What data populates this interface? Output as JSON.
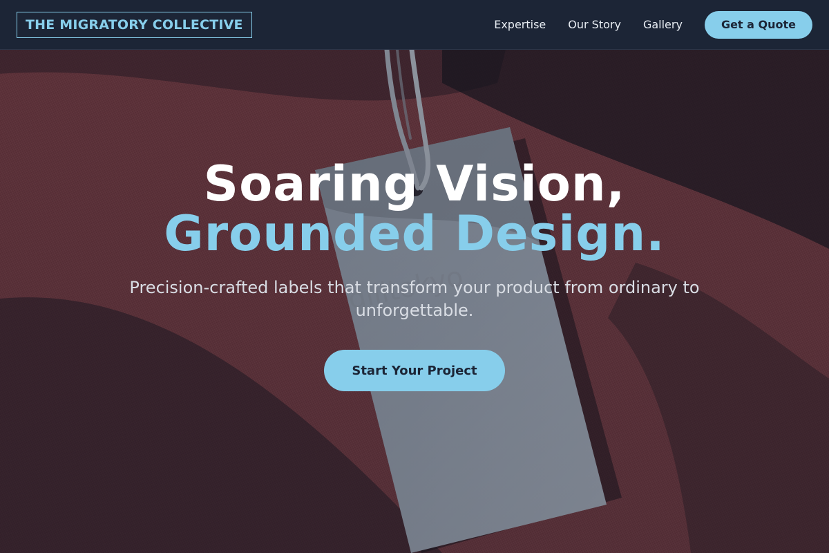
{
  "header": {
    "logo_text": "THE MIGRATORY COLLECTIVE",
    "nav": [
      {
        "label": "Expertise"
      },
      {
        "label": "Our Story"
      },
      {
        "label": "Gallery"
      }
    ],
    "quote_button": "Get a Quote"
  },
  "hero": {
    "headline_line1": "Soaring Vision,",
    "headline_line2": "Grounded Design.",
    "subtitle": "Precision-crafted labels that transform your product from ordinary to unforgettable.",
    "cta_button": "Start Your Project",
    "tag_imprint": "gilltokyo",
    "background_image": "hang-tag-on-burgundy-fabric"
  },
  "colors": {
    "accent": "#87ceeb",
    "header_bg": "#1c2536",
    "text_light": "#ffffff",
    "fabric": "#6e363d"
  }
}
